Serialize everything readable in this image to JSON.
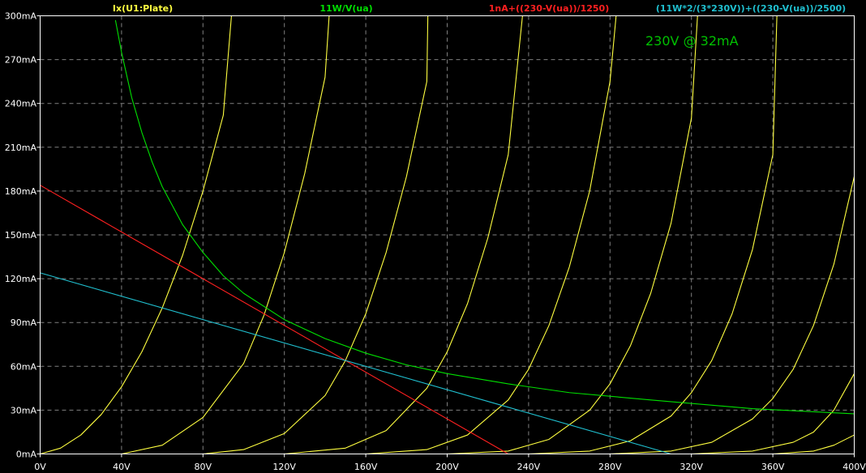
{
  "chart_data": {
    "type": "line",
    "xlim": [
      0,
      400
    ],
    "ylim": [
      0,
      300
    ],
    "x_unit": "V",
    "y_unit": "mA",
    "grid": true,
    "background": "#000000",
    "colors": {
      "plate_curves": "#ffff40",
      "hyperbola": "#00e000",
      "load_line_red": "#ff2020",
      "load_line_cyan": "#20c0d0",
      "axis_labels": "#ffffff",
      "grid": "#808080"
    },
    "x_ticks": [
      "0V",
      "40V",
      "80V",
      "120V",
      "160V",
      "200V",
      "240V",
      "280V",
      "320V",
      "360V",
      "400V"
    ],
    "y_ticks": [
      "0mA",
      "30mA",
      "60mA",
      "90mA",
      "120mA",
      "150mA",
      "180mA",
      "210mA",
      "240mA",
      "270mA",
      "300mA"
    ],
    "legend": [
      {
        "label": "Ix(U1:Plate)",
        "color": "#ffff40"
      },
      {
        "label": "11W/V(ua)",
        "color": "#00e000"
      },
      {
        "label": "1nA+((230-V(ua))/1250)",
        "color": "#ff2020"
      },
      {
        "label": "(11W*2/(3*230V))+((230-V(ua))/2500)",
        "color": "#20c0d0"
      }
    ],
    "annotation": {
      "text": "230V @ 32mA",
      "color": "#00c000"
    },
    "series": [
      {
        "name": "Ix(U1:Plate)",
        "color": "#ffff40",
        "x": [
          0,
          10,
          20,
          30,
          40,
          50,
          60,
          70,
          80,
          90,
          94
        ],
        "y": [
          0,
          4,
          13,
          27,
          46,
          70,
          100,
          136,
          180,
          232,
          300
        ]
      },
      {
        "name": "Ix(U1:Plate)",
        "color": "#ffff40",
        "x": [
          40,
          60,
          80,
          100,
          110,
          120,
          130,
          140,
          142
        ],
        "y": [
          0,
          6,
          25,
          62,
          95,
          138,
          192,
          258,
          300
        ]
      },
      {
        "name": "Ix(U1:Plate)",
        "color": "#ffff40",
        "x": [
          80,
          100,
          120,
          140,
          150,
          160,
          170,
          180,
          190,
          190.5
        ],
        "y": [
          0,
          3,
          14,
          40,
          64,
          96,
          138,
          190,
          255,
          300
        ]
      },
      {
        "name": "Ix(U1:Plate)",
        "color": "#ffff40",
        "x": [
          120,
          150,
          170,
          190,
          200,
          210,
          220,
          230,
          237
        ],
        "y": [
          0,
          4,
          16,
          45,
          70,
          103,
          148,
          205,
          300
        ]
      },
      {
        "name": "Ix(U1:Plate)",
        "color": "#ffff40",
        "x": [
          160,
          190,
          210,
          230,
          240,
          250,
          260,
          270,
          280,
          283
        ],
        "y": [
          0,
          3,
          13,
          37,
          58,
          88,
          128,
          180,
          255,
          300
        ]
      },
      {
        "name": "Ix(U1:Plate)",
        "color": "#ffff40",
        "x": [
          200,
          230,
          250,
          270,
          280,
          290,
          300,
          310,
          320,
          323
        ],
        "y": [
          0,
          2,
          10,
          30,
          48,
          74,
          110,
          158,
          230,
          300
        ]
      },
      {
        "name": "Ix(U1:Plate)",
        "color": "#ffff40",
        "x": [
          240,
          270,
          290,
          310,
          320,
          330,
          340,
          350,
          360,
          362
        ],
        "y": [
          0,
          2,
          9,
          26,
          42,
          64,
          96,
          140,
          205,
          300
        ]
      },
      {
        "name": "Ix(U1:Plate)",
        "color": "#ffff40",
        "x": [
          280,
          310,
          330,
          350,
          360,
          370,
          380,
          390,
          400
        ],
        "y": [
          0,
          2,
          8,
          24,
          38,
          58,
          88,
          130,
          190
        ]
      },
      {
        "name": "Ix(U1:Plate)",
        "color": "#ffff40",
        "x": [
          320,
          350,
          370,
          380,
          390,
          400
        ],
        "y": [
          0,
          2,
          8,
          15,
          30,
          55
        ]
      },
      {
        "name": "Ix(U1:Plate)",
        "color": "#ffff40",
        "x": [
          360,
          380,
          390,
          400
        ],
        "y": [
          0,
          2,
          6,
          13
        ]
      },
      {
        "name": "11W/V(ua)",
        "color": "#00e000",
        "x": [
          37,
          40,
          45,
          50,
          55,
          60,
          70,
          80,
          90,
          100,
          120,
          140,
          160,
          180,
          200,
          230,
          260,
          300,
          350,
          400
        ],
        "y": [
          297,
          275,
          244,
          220,
          200,
          183,
          157,
          138,
          122,
          110,
          92,
          79,
          69,
          61,
          55,
          48,
          42,
          37,
          31,
          27.5
        ]
      },
      {
        "name": "1nA+((230-V(ua))/1250)",
        "color": "#ff2020",
        "x": [
          0,
          230
        ],
        "y": [
          184,
          0
        ]
      },
      {
        "name": "(11W*2/(3*230V))+((230-V(ua))/2500)",
        "color": "#20c0d0",
        "x": [
          0,
          230,
          310
        ],
        "y": [
          124,
          32,
          0
        ]
      }
    ]
  }
}
